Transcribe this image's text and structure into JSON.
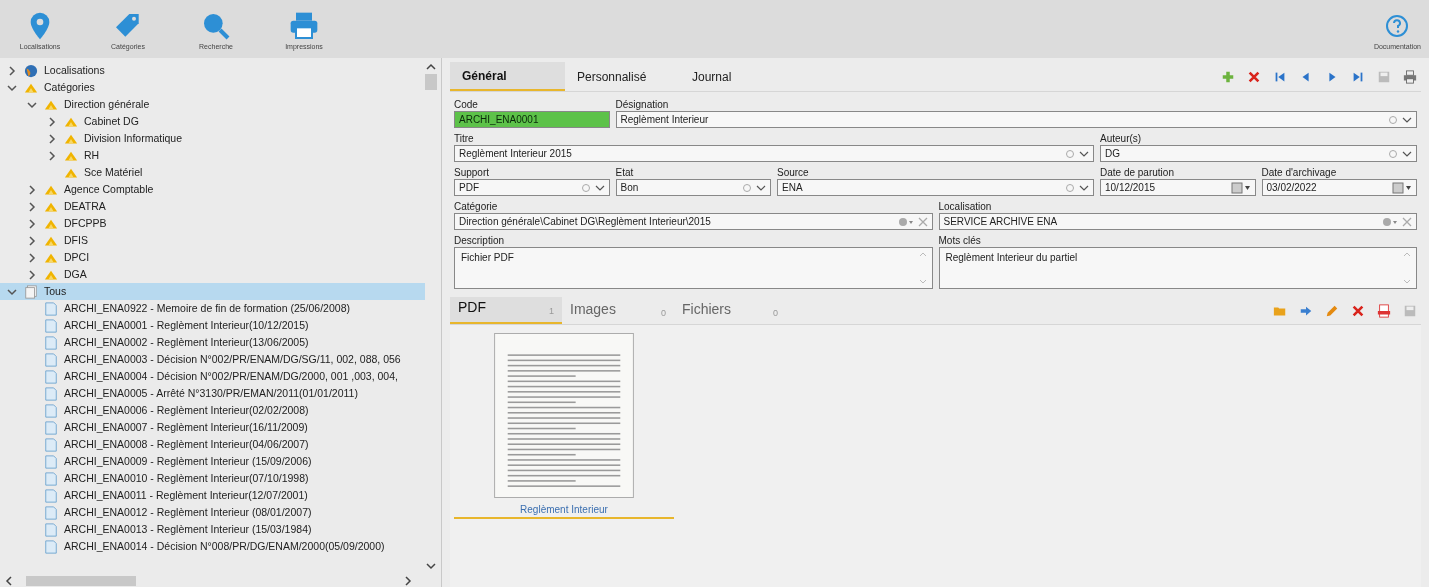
{
  "toolbar": [
    {
      "label": "Localisations",
      "kind": "pin"
    },
    {
      "label": "Catégories",
      "kind": "tag"
    },
    {
      "label": "Recherche",
      "kind": "search"
    },
    {
      "label": "Impressions",
      "kind": "printer"
    }
  ],
  "help": {
    "label": "Documentation"
  },
  "tree": [
    {
      "label": "Localisations",
      "kind": "globe",
      "expanded": false,
      "selected": false
    },
    {
      "label": "Catégories",
      "kind": "folder",
      "expanded": true,
      "selected": false,
      "children": [
        {
          "label": "Direction générale",
          "kind": "folder",
          "expanded": true,
          "selected": false,
          "children": [
            {
              "label": "Cabinet DG",
              "kind": "folder",
              "expanded": false,
              "selected": false
            },
            {
              "label": "Division Informatique",
              "kind": "folder",
              "expanded": false,
              "selected": false
            },
            {
              "label": "RH",
              "kind": "folder",
              "expanded": false,
              "selected": false
            },
            {
              "label": "Sce Matériel",
              "kind": "folder",
              "selected": false
            }
          ]
        },
        {
          "label": "Agence Comptable",
          "kind": "folder",
          "expanded": false,
          "selected": false
        },
        {
          "label": "DEATRA",
          "kind": "folder",
          "expanded": false,
          "selected": false
        },
        {
          "label": "DFCPPB",
          "kind": "folder",
          "expanded": false,
          "selected": false
        },
        {
          "label": "DFIS",
          "kind": "folder",
          "expanded": false,
          "selected": false
        },
        {
          "label": "DPCI",
          "kind": "folder",
          "expanded": false,
          "selected": false
        },
        {
          "label": "DGA",
          "kind": "folder",
          "expanded": false,
          "selected": false
        }
      ]
    },
    {
      "label": "Tous",
      "kind": "all",
      "expanded": true,
      "selected": true,
      "children": [
        {
          "label": "ARCHI_ENA0922 - Memoire de fin de formation (25/06/2008)",
          "kind": "doc",
          "selected": false
        },
        {
          "label": "ARCHI_ENA0001 - Reglèment Interieur(10/12/2015)",
          "kind": "doc",
          "selected": false
        },
        {
          "label": "ARCHI_ENA0002 - Reglèment Interieur(13/06/2005)",
          "kind": "doc",
          "selected": false
        },
        {
          "label": "ARCHI_ENA0003 - Décision N°002/PR/ENAM/DG/SG/11, 002, 088, 056",
          "kind": "doc",
          "selected": false
        },
        {
          "label": "ARCHI_ENA0004 - Décision N°002/PR/ENAM/DG/2000, 001 ,003, 004,",
          "kind": "doc",
          "selected": false
        },
        {
          "label": "ARCHI_ENA0005 - Arrêté N°3130/PR/EMAN/2011(01/01/2011)",
          "kind": "doc",
          "selected": false
        },
        {
          "label": "ARCHI_ENA0006 - Reglèment Interieur(02/02/2008)",
          "kind": "doc",
          "selected": false
        },
        {
          "label": "ARCHI_ENA0007 - Reglèment Interieur(16/11/2009)",
          "kind": "doc",
          "selected": false
        },
        {
          "label": "ARCHI_ENA0008 - Reglèment Interieur(04/06/2007)",
          "kind": "doc",
          "selected": false
        },
        {
          "label": "ARCHI_ENA0009 - Reglèment Interieur (15/09/2006)",
          "kind": "doc",
          "selected": false
        },
        {
          "label": "ARCHI_ENA0010 - Reglèment Interieur(07/10/1998)",
          "kind": "doc",
          "selected": false
        },
        {
          "label": "ARCHI_ENA0011 - Reglèment Interieur(12/07/2001)",
          "kind": "doc",
          "selected": false
        },
        {
          "label": "ARCHI_ENA0012 - Reglèment Interieur (08/01/2007)",
          "kind": "doc",
          "selected": false
        },
        {
          "label": "ARCHI_ENA0013 - Reglèment Interieur (15/03/1984)",
          "kind": "doc",
          "selected": false
        },
        {
          "label": "ARCHI_ENA0014 - Décision N°008/PR/DG/ENAM/2000(05/09/2000)",
          "kind": "doc",
          "selected": false
        }
      ]
    }
  ],
  "tabs": [
    {
      "label": "Général",
      "selected": true
    },
    {
      "label": "Personnalisé",
      "selected": false
    },
    {
      "label": "Journal",
      "selected": false
    }
  ],
  "form": [
    [
      {
        "label": "Code",
        "value": "ARCHI_ENA0001",
        "kind": "code"
      },
      {
        "label": "Désignation",
        "value": "Reglèment Interieur",
        "kind": "combo"
      }
    ],
    [
      {
        "label": "Titre",
        "value": "Reglèment Interieur 2015",
        "kind": "combo"
      },
      {
        "label": "Auteur(s)",
        "value": "DG",
        "kind": "combo"
      }
    ],
    [
      {
        "label": "Support",
        "value": "PDF",
        "kind": "combo"
      },
      {
        "label": "Etat",
        "value": "Bon",
        "kind": "combo"
      },
      {
        "label": "Source",
        "value": "ENA",
        "kind": "combo"
      },
      {
        "label": "Date de parution",
        "value": "10/12/2015",
        "kind": "date"
      },
      {
        "label": "Date d'archivage",
        "value": "03/02/2022",
        "kind": "date"
      }
    ],
    [
      {
        "label": "Catégorie",
        "value": "Direction générale\\Cabinet DG\\Reglèment Interieur\\2015",
        "kind": "lookup"
      },
      {
        "label": "Localisation",
        "value": "SERVICE ARCHIVE ENA",
        "kind": "lookup"
      }
    ],
    [
      {
        "label": "Description",
        "value": "Fichier PDF",
        "kind": "textarea"
      },
      {
        "label": "Mots clés",
        "value": "Reglèment Interieur du partiel",
        "kind": "textarea"
      }
    ]
  ],
  "attachment_tabs": [
    {
      "label": "PDF",
      "count": "1",
      "selected": true
    },
    {
      "label": "Images",
      "count": "0",
      "selected": false
    },
    {
      "label": "Fichiers",
      "count": "0",
      "selected": false
    }
  ],
  "documents": [
    {
      "caption": "Reglèment Interieur",
      "selected": true
    }
  ]
}
